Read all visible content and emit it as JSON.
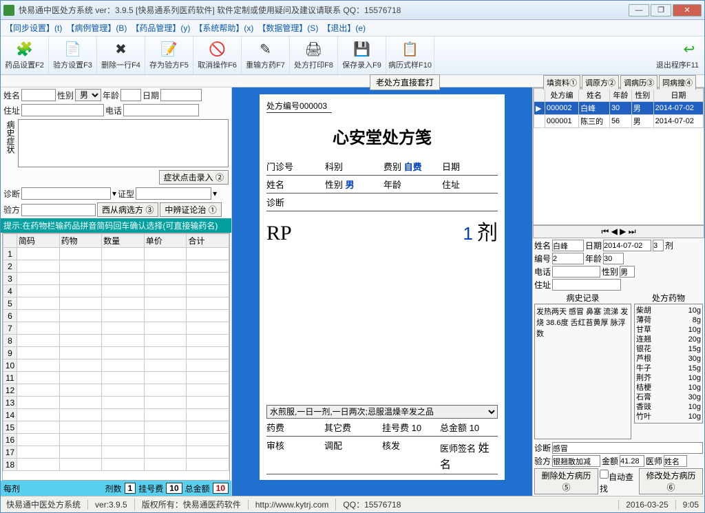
{
  "window": {
    "title": "快易通中医处方系统  ver：3.9.5 [快易通系列医药软件]          软件定制或使用疑问及建议请联系 QQ：15576718",
    "min": "—",
    "max": "❐",
    "close": "✕"
  },
  "menu": {
    "sync": "【同步设置】(t)",
    "case": "【病例管理】(B)",
    "drug": "【药品管理】(y)",
    "help": "【系统帮助】(x)",
    "data": "【数据管理】(S)",
    "exit": "【退出】(e)"
  },
  "toolbar": {
    "t1": "药品设置F2",
    "t2": "验方设置F3",
    "t3": "删除一行F4",
    "t4": "存为验方F5",
    "t5": "取消操作F6",
    "t6": "重输方药F7",
    "t7": "处方打印F8",
    "t8": "保存录入F9",
    "t9": "病历式样F10",
    "t10": "退出程序F11"
  },
  "oldrx": "老处方直接套打",
  "rtabs": {
    "a": "填资料①",
    "b": "调原方②",
    "c": "调病历③",
    "d": "同病搜④"
  },
  "left": {
    "name_l": "姓名",
    "sex_l": "性别",
    "sex_v": "男",
    "age_l": "年龄",
    "date_l": "日期",
    "addr_l": "住址",
    "tel_l": "电话",
    "sympt_l": "病史症状",
    "sympt_btn": "症状点击录入 ②",
    "diag_l": "诊断",
    "zheng_l": "证型",
    "yf_l": "验方",
    "xf_btn": "西从病选方 ③",
    "zb_btn": "中辨证论治 ①",
    "hint": "提示:在药物栏输药品拼音简码回车确认选择(可直接输药名)",
    "cols": {
      "c1": "简码",
      "c2": "药物",
      "c3": "数量",
      "c4": "单价",
      "c5": "合计"
    },
    "sum": {
      "per": "每剂",
      "cnt_l": "剂数",
      "cnt_v": "1",
      "reg_l": "挂号费",
      "reg_v": "10",
      "tot_l": "总金额",
      "tot_v": "10"
    }
  },
  "sheet": {
    "no_l": "处方编号",
    "no_v": "000003",
    "title": "心安堂处方笺",
    "r1": {
      "a": "门诊号",
      "b": "科别",
      "c": "费别",
      "cv": "自费",
      "d": "日期"
    },
    "r2": {
      "a": "姓名",
      "b": "性别",
      "bv": "男",
      "c": "年龄",
      "d": "住址"
    },
    "r3": "诊断",
    "rp": "RP",
    "rnum": "1",
    "rji": "剂",
    "instr": "水煎服,一日一剂,一日两次;忌服温燥辛发之品",
    "f1": {
      "a": "药费",
      "b": "其它费",
      "c": "挂号费",
      "cv": "10",
      "d": "总金额",
      "dv": "10"
    },
    "f2": {
      "a": "审核",
      "b": "调配",
      "c": "核发",
      "d": "医师签名",
      "dv": "姓名"
    }
  },
  "rlist": {
    "cols": {
      "c1": "处方编",
      "c2": "姓名",
      "c3": "年龄",
      "c4": "性别",
      "c5": "日期"
    },
    "rows": [
      {
        "no": "000002",
        "name": "白峰",
        "age": "30",
        "sex": "男",
        "date": "2014-07-02"
      },
      {
        "no": "000001",
        "name": "陈三的",
        "age": "56",
        "sex": "男",
        "date": "2014-07-02"
      }
    ]
  },
  "rform": {
    "name_l": "姓名",
    "name_v": "白峰",
    "date_l": "日期",
    "date_v": "2014-07-02",
    "dose_v": "3",
    "dose_u": "剂",
    "no_l": "编号",
    "no_v": "2",
    "age_l": "年龄",
    "age_v": "30",
    "tel_l": "电话",
    "sex_l": "性别",
    "sex_v": "男",
    "addr_l": "住址",
    "hist_l": "病史记录",
    "hist_t": "发热两天 感冒 鼻塞 流涕 发烧 38.6度 舌红苔黄厚 脉浮数",
    "med_l": "处方药物",
    "meds": [
      {
        "n": "柴胡",
        "q": "10g"
      },
      {
        "n": "薄荷",
        "q": "8g"
      },
      {
        "n": "甘草",
        "q": "10g"
      },
      {
        "n": "连翘",
        "q": "20g"
      },
      {
        "n": "银花",
        "q": "15g"
      },
      {
        "n": "芦根",
        "q": "30g"
      },
      {
        "n": "牛子",
        "q": "15g"
      },
      {
        "n": "荆芥",
        "q": "10g"
      },
      {
        "n": "桔梗",
        "q": "10g"
      },
      {
        "n": "石膏",
        "q": "30g"
      },
      {
        "n": "香豉",
        "q": "10g"
      },
      {
        "n": "竹叶",
        "q": "10g"
      }
    ],
    "diag_l": "诊断",
    "diag_v": "感冒",
    "yf_l": "验方",
    "yf_v": "银翘散加减",
    "amt_l": "金额",
    "amt_v": "41.28",
    "doc_l": "医师",
    "doc_v": "姓名",
    "del_l": "删除处方病历 ⑤",
    "auto_l": "自动查找",
    "mod_l": "修改处方病历 ⑥"
  },
  "status": {
    "s1": "快易通中医处方系统",
    "s2": "ver:3.9.5",
    "s3": "版权所有：快易通医药软件",
    "s4": "http://www.kytrj.com",
    "s5": "QQ：15576718",
    "s6": "2016-03-25",
    "s7": "9:05"
  }
}
